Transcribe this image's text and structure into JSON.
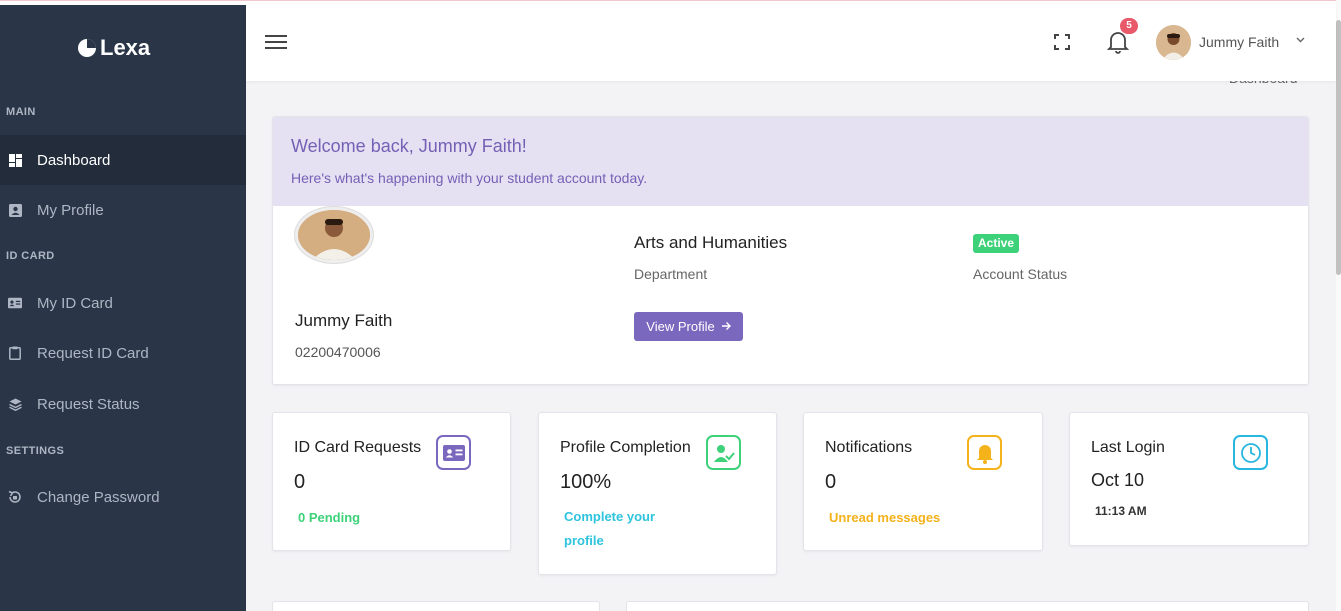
{
  "brand": {
    "name": "Lexa"
  },
  "sidebar": {
    "sections": [
      {
        "title": "MAIN"
      },
      {
        "title": "ID CARD"
      },
      {
        "title": "SETTINGS"
      }
    ],
    "items": [
      {
        "label": "Dashboard",
        "icon": "dashboard-icon"
      },
      {
        "label": "My Profile",
        "icon": "profile-icon"
      },
      {
        "label": "My ID Card",
        "icon": "id-card-icon"
      },
      {
        "label": "Request ID Card",
        "icon": "clipboard-icon"
      },
      {
        "label": "Request Status",
        "icon": "layers-icon"
      },
      {
        "label": "Change Password",
        "icon": "lock-reset-icon"
      }
    ]
  },
  "header": {
    "notification_count": "5",
    "user_name": "Jummy Faith"
  },
  "page": {
    "title": "Dashboard",
    "breadcrumb": "Dashboard"
  },
  "welcome": {
    "title": "Welcome back, Jummy Faith!",
    "subtitle": "Here's what's happening with your student account today.",
    "student_name": "Jummy Faith",
    "student_id": "02200470006",
    "department": "Arts and Humanities",
    "department_label": "Department",
    "view_profile_label": "View Profile",
    "status_badge": "Active",
    "status_label": "Account Status"
  },
  "stats": [
    {
      "label": "ID Card Requests",
      "value": "0",
      "sub": "0 Pending",
      "color": "#7a68bf",
      "icon": "id-card-icon"
    },
    {
      "label": "Profile Completion",
      "value": "100%",
      "sub": "Complete your profile",
      "color": "#3dd27a",
      "icon": "user-check-icon"
    },
    {
      "label": "Notifications",
      "value": "0",
      "sub": "Unread messages",
      "color": "#f4b21b",
      "icon": "bell-icon"
    },
    {
      "label": "Last Login",
      "value": "Oct 10",
      "sub": "11:13 AM",
      "color": "#28b7e0",
      "icon": "clock-icon"
    }
  ],
  "colors": {
    "sidebar_bg": "#2a3547",
    "accent": "#7a68bf",
    "success": "#3dd27a",
    "warning": "#f4b21b",
    "info": "#28b7e0",
    "sub_info": "#2ec4dd"
  }
}
